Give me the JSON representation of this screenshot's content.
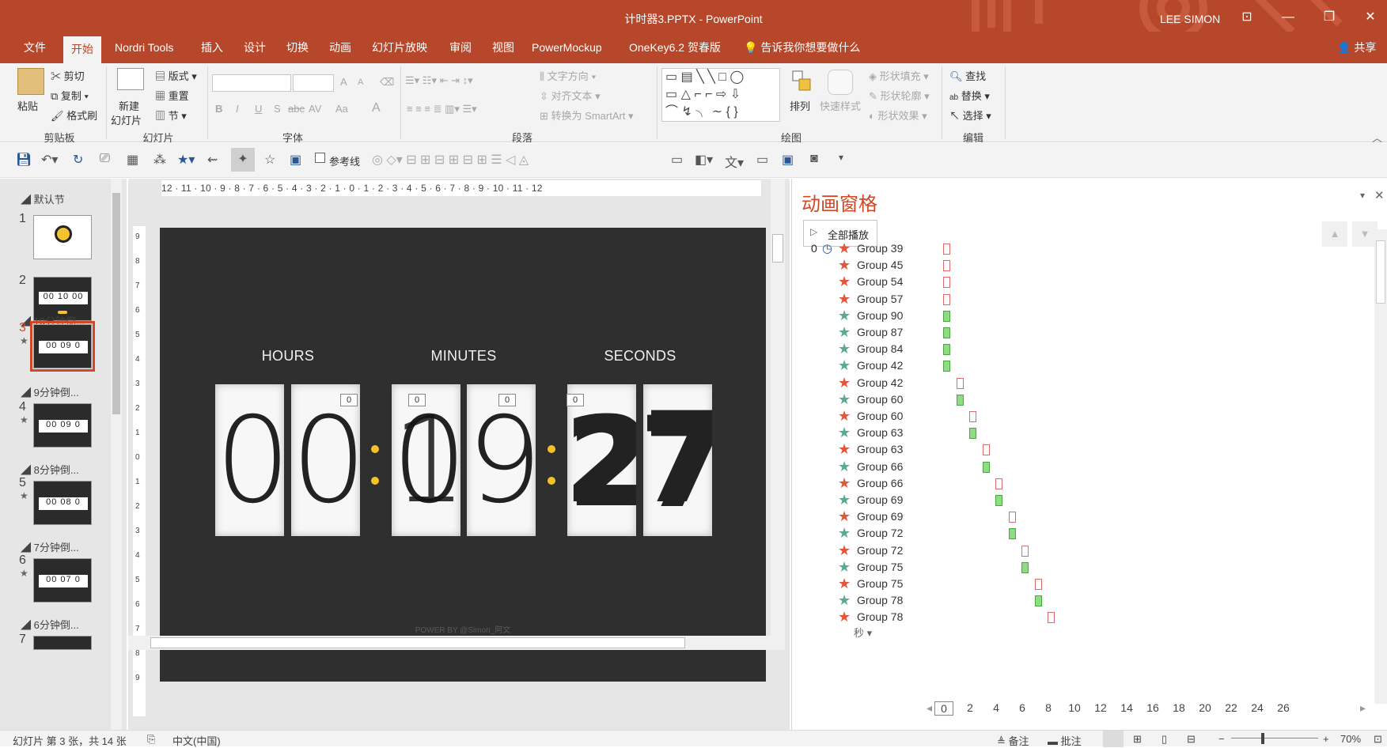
{
  "window": {
    "title": "计时器3.PPTX - PowerPoint",
    "user": "LEE SIMON"
  },
  "tabs": [
    "文件",
    "开始",
    "Nordri Tools",
    "插入",
    "设计",
    "切换",
    "动画",
    "幻灯片放映",
    "审阅",
    "视图",
    "PowerMockup",
    "OneKey6.2 贺春版"
  ],
  "active_tab": "开始",
  "tell_me": "告诉我你想要做什么",
  "share": "共享",
  "ribbon": {
    "clipboard": {
      "paste": "粘贴",
      "cut": "剪切",
      "copy": "复制",
      "format_painter": "格式刷",
      "label": "剪贴板"
    },
    "slides": {
      "new_slide": "新建",
      "new_slide2": "幻灯片",
      "layout": "版式",
      "reset": "重置",
      "section": "节",
      "label": "幻灯片"
    },
    "font": {
      "label": "字体",
      "bold": "B",
      "italic": "I",
      "underline": "U",
      "shadow": "S",
      "strike": "abc",
      "spacing": "AV",
      "case": "Aa",
      "grow": "A",
      "shrink": "A"
    },
    "paragraph": {
      "label": "段落",
      "text_direction": "文字方向",
      "align_text": "对齐文本",
      "smartart": "转换为 SmartArt"
    },
    "drawing": {
      "label": "绘图",
      "arrange": "排列",
      "quick_styles": "快速样式",
      "fill": "形状填充",
      "outline": "形状轮廓",
      "effects": "形状效果"
    },
    "editing": {
      "label": "编辑",
      "find": "查找",
      "replace": "替换",
      "select": "选择"
    }
  },
  "qat": {
    "guides": "参考线"
  },
  "thumbnails": {
    "sections": [
      "默认节",
      "10分钟倒...",
      "9分钟倒...",
      "8分钟倒...",
      "7分钟倒...",
      "6分钟倒..."
    ],
    "slides": [
      {
        "num": "1",
        "star": ""
      },
      {
        "num": "2",
        "star": ""
      },
      {
        "num": "3",
        "star": "★"
      },
      {
        "num": "4",
        "star": "★"
      },
      {
        "num": "5",
        "star": "★"
      },
      {
        "num": "6",
        "star": "★"
      },
      {
        "num": "7",
        "star": ""
      }
    ],
    "selected": "3"
  },
  "ruler": {
    "horizontal": "12 · 11 · 10 · 9 · 8 · 7 · 6 · 5 · 4 · 3 · 2 · 1 · 0 · 1 · 2 · 3 · 4 · 5 · 6 · 7 · 8 · 9 · 10 · 11 · 12"
  },
  "slide": {
    "labels": {
      "hours": "HOURS",
      "minutes": "MINUTES",
      "seconds": "SECONDS"
    },
    "digits": {
      "h1": "0",
      "h2": "0",
      "m1": "0",
      "m1_over": "1",
      "m2": "9",
      "s1": "2",
      "s2": "7"
    },
    "anim_tags": [
      "0",
      "0",
      "0",
      "0"
    ],
    "credit": "POWER BY @Simon_阿文",
    "accent_color": "#f7c12b"
  },
  "animation_pane": {
    "title": "动画窗格",
    "play_all": "全部播放",
    "start_index": "0",
    "rows": [
      {
        "name": "Group 39",
        "effect": "exit",
        "start": 0.0
      },
      {
        "name": "Group 45",
        "effect": "exit",
        "start": 0.0
      },
      {
        "name": "Group 54",
        "effect": "exit",
        "start": 0.0
      },
      {
        "name": "Group 57",
        "effect": "exit",
        "start": 0.0
      },
      {
        "name": "Group 90",
        "effect": "entry",
        "start": 0.0
      },
      {
        "name": "Group 87",
        "effect": "entry",
        "start": 0.0
      },
      {
        "name": "Group 84",
        "effect": "entry",
        "start": 0.0
      },
      {
        "name": "Group 42",
        "effect": "entry",
        "start": 0.0
      },
      {
        "name": "Group 42",
        "effect": "exit",
        "start": 1.0
      },
      {
        "name": "Group 60",
        "effect": "entry",
        "start": 1.0
      },
      {
        "name": "Group 60",
        "effect": "exit",
        "start": 2.0
      },
      {
        "name": "Group 63",
        "effect": "entry",
        "start": 2.0
      },
      {
        "name": "Group 63",
        "effect": "exit",
        "start": 3.0
      },
      {
        "name": "Group 66",
        "effect": "entry",
        "start": 3.0
      },
      {
        "name": "Group 66",
        "effect": "exit",
        "start": 4.0
      },
      {
        "name": "Group 69",
        "effect": "entry",
        "start": 4.0
      },
      {
        "name": "Group 69",
        "effect": "exit",
        "start": 5.0
      },
      {
        "name": "Group 72",
        "effect": "entry",
        "start": 5.0
      },
      {
        "name": "Group 72",
        "effect": "exit",
        "start": 6.0
      },
      {
        "name": "Group 75",
        "effect": "entry",
        "start": 6.0
      },
      {
        "name": "Group 75",
        "effect": "exit",
        "start": 7.0
      },
      {
        "name": "Group 78",
        "effect": "entry",
        "start": 7.0
      },
      {
        "name": "Group 78",
        "effect": "exit",
        "start": 8.0
      }
    ],
    "entry_color": "#8fdc83",
    "exit_color": "#e06a6a",
    "timeline": {
      "unit": "秒",
      "ticks": [
        "0",
        "2",
        "4",
        "6",
        "8",
        "10",
        "12",
        "14",
        "16",
        "18",
        "20",
        "22",
        "24",
        "26"
      ]
    }
  },
  "status": {
    "slide_info": "幻灯片 第 3 张，共 14 张",
    "language": "中文(中国)",
    "notes": "备注",
    "comments": "批注",
    "zoom": "70%"
  }
}
